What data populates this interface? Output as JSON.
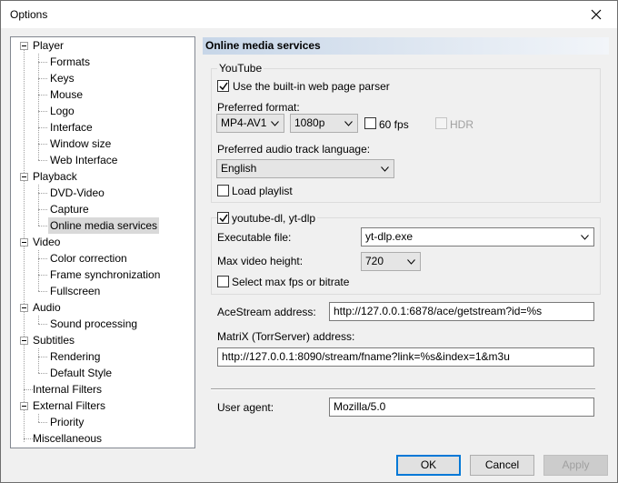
{
  "window": {
    "title": "Options"
  },
  "tree": {
    "items": [
      {
        "label": "Player"
      },
      {
        "label": "Formats"
      },
      {
        "label": "Keys"
      },
      {
        "label": "Mouse"
      },
      {
        "label": "Logo"
      },
      {
        "label": "Interface"
      },
      {
        "label": "Window size"
      },
      {
        "label": "Web Interface"
      },
      {
        "label": "Playback"
      },
      {
        "label": "DVD-Video"
      },
      {
        "label": "Capture"
      },
      {
        "label": "Online media services"
      },
      {
        "label": "Video"
      },
      {
        "label": "Color correction"
      },
      {
        "label": "Frame synchronization"
      },
      {
        "label": "Fullscreen"
      },
      {
        "label": "Audio"
      },
      {
        "label": "Sound processing"
      },
      {
        "label": "Subtitles"
      },
      {
        "label": "Rendering"
      },
      {
        "label": "Default Style"
      },
      {
        "label": "Internal Filters"
      },
      {
        "label": "External Filters"
      },
      {
        "label": "Priority"
      },
      {
        "label": "Miscellaneous"
      }
    ],
    "selected": "Online media services"
  },
  "panel": {
    "title": "Online media services",
    "youtube": {
      "group_label": "YouTube",
      "use_parser_label": "Use the built-in web page parser",
      "use_parser_checked": true,
      "preferred_format_label": "Preferred format:",
      "format_value": "MP4-AV1",
      "resolution_value": "1080p",
      "fps60_label": "60 fps",
      "fps60_checked": false,
      "hdr_label": "HDR",
      "hdr_checked": false,
      "audio_lang_label": "Preferred audio track language:",
      "audio_lang_value": "English",
      "load_playlist_label": "Load playlist",
      "load_playlist_checked": false
    },
    "ytdl": {
      "group_label": "youtube-dl, yt-dlp",
      "enabled": true,
      "exec_label": "Executable file:",
      "exec_value": "yt-dlp.exe",
      "max_height_label": "Max video height:",
      "max_height_value": "720",
      "select_max_fps_label": "Select max fps or bitrate",
      "select_max_fps_checked": false
    },
    "acestream_label": "AceStream address:",
    "acestream_value": "http://127.0.0.1:6878/ace/getstream?id=%s",
    "matrix_label": "MatriX (TorrServer) address:",
    "matrix_value": "http://127.0.0.1:8090/stream/fname?link=%s&index=1&m3u",
    "user_agent_label": "User agent:",
    "user_agent_value": "Mozilla/5.0"
  },
  "buttons": {
    "ok": "OK",
    "cancel": "Cancel",
    "apply": "Apply"
  }
}
